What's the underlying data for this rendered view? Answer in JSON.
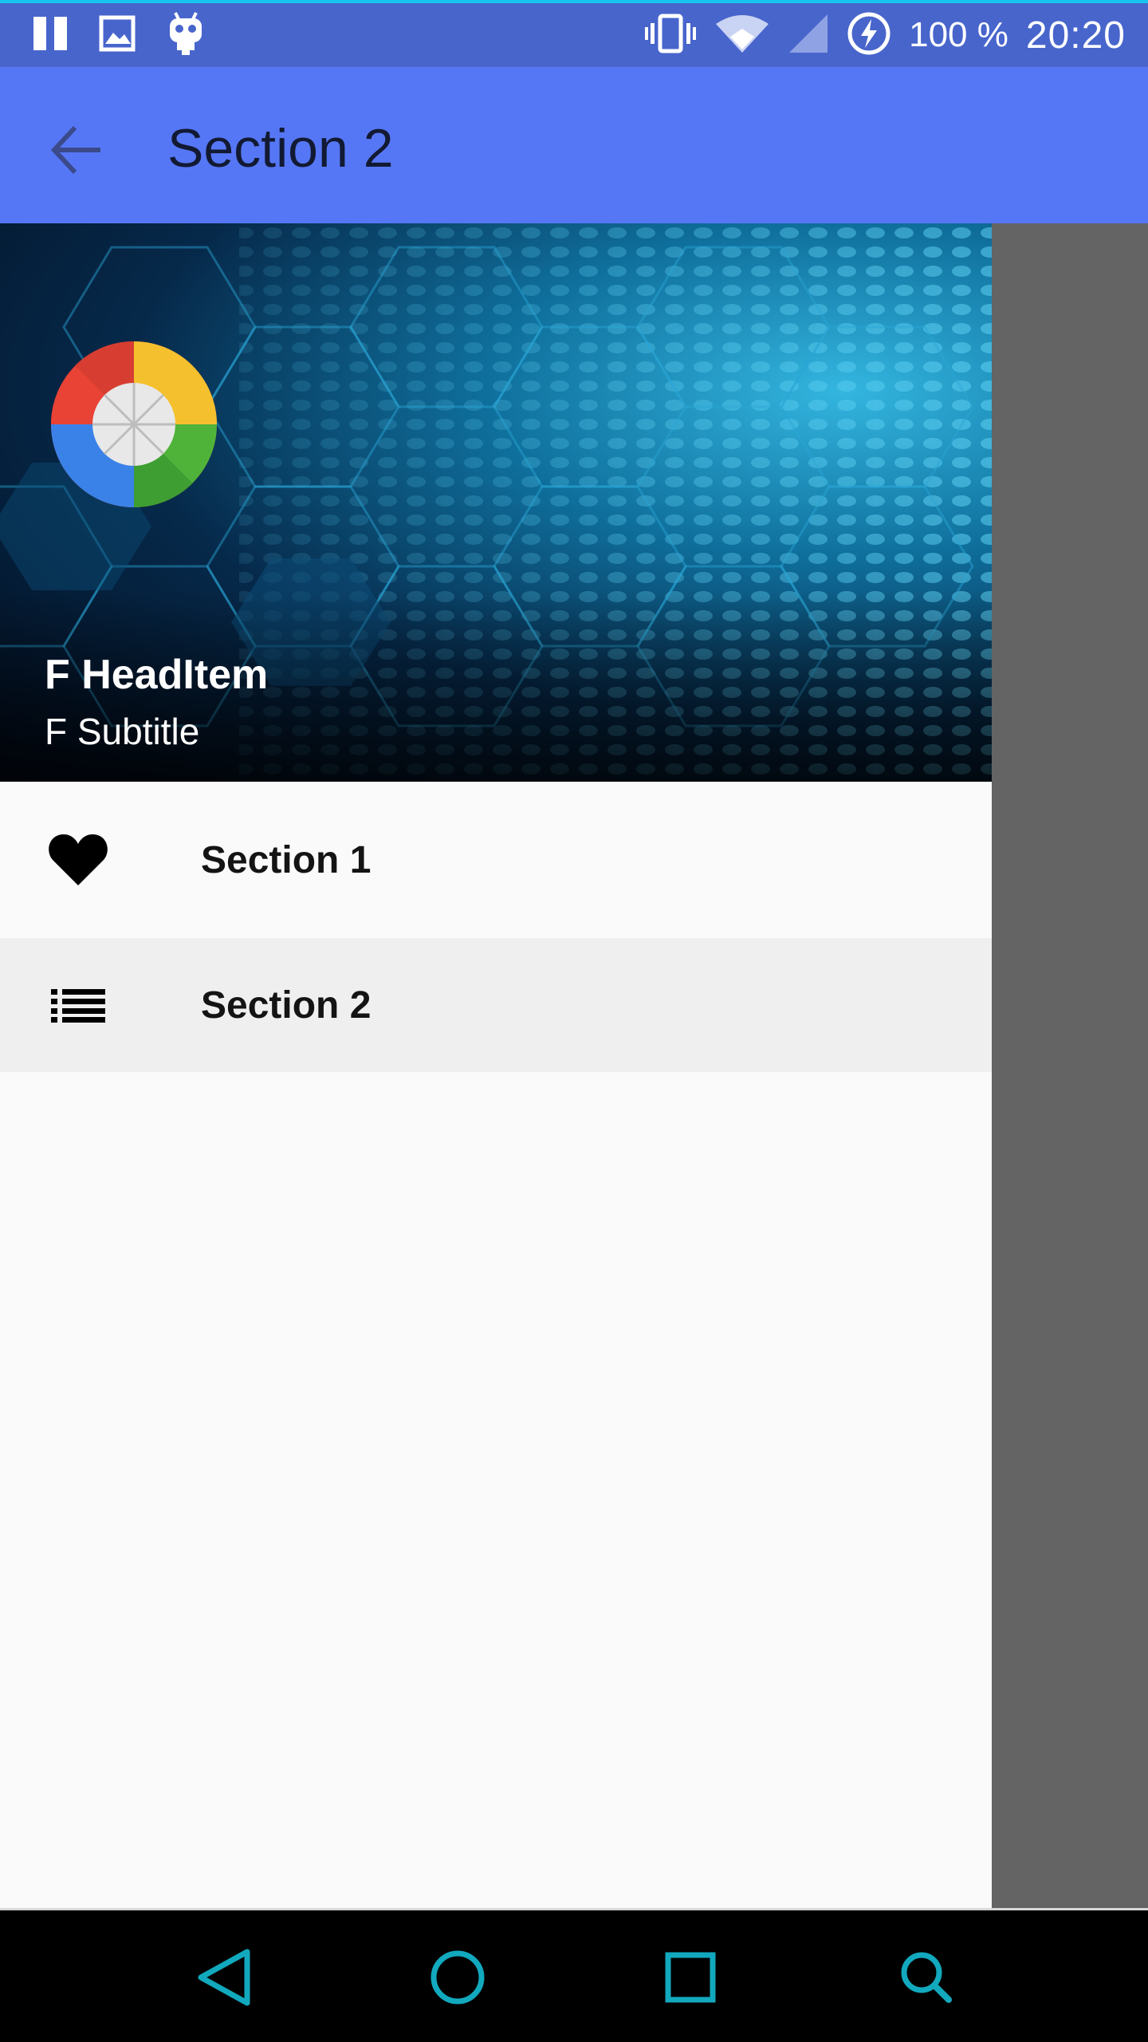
{
  "status_bar": {
    "battery_percent": "100 %",
    "time": "20:20",
    "icons": [
      "pause-icon",
      "image-icon",
      "android-icon",
      "vibrate-icon",
      "wifi-icon",
      "signal-icon",
      "battery-charging-icon"
    ]
  },
  "app_bar": {
    "title": "Section 2",
    "back_icon": "arrow-back-icon"
  },
  "drawer": {
    "header": {
      "title": "F HeadItem",
      "subtitle": "F Subtitle"
    },
    "items": [
      {
        "label": "Section 1",
        "icon": "heart-icon",
        "active": false
      },
      {
        "label": "Section 2",
        "icon": "list-icon",
        "active": true
      }
    ]
  },
  "nav_bar": {
    "buttons": [
      "back-triangle-icon",
      "home-circle-icon",
      "recents-square-icon",
      "search-icon"
    ],
    "accent": "#12a9be"
  },
  "colors": {
    "status_bar": "#4865cc",
    "app_bar": "#5677f5",
    "drawer_bg": "#fafafa",
    "active_item_bg": "#efefef",
    "scrim": "#646464"
  }
}
